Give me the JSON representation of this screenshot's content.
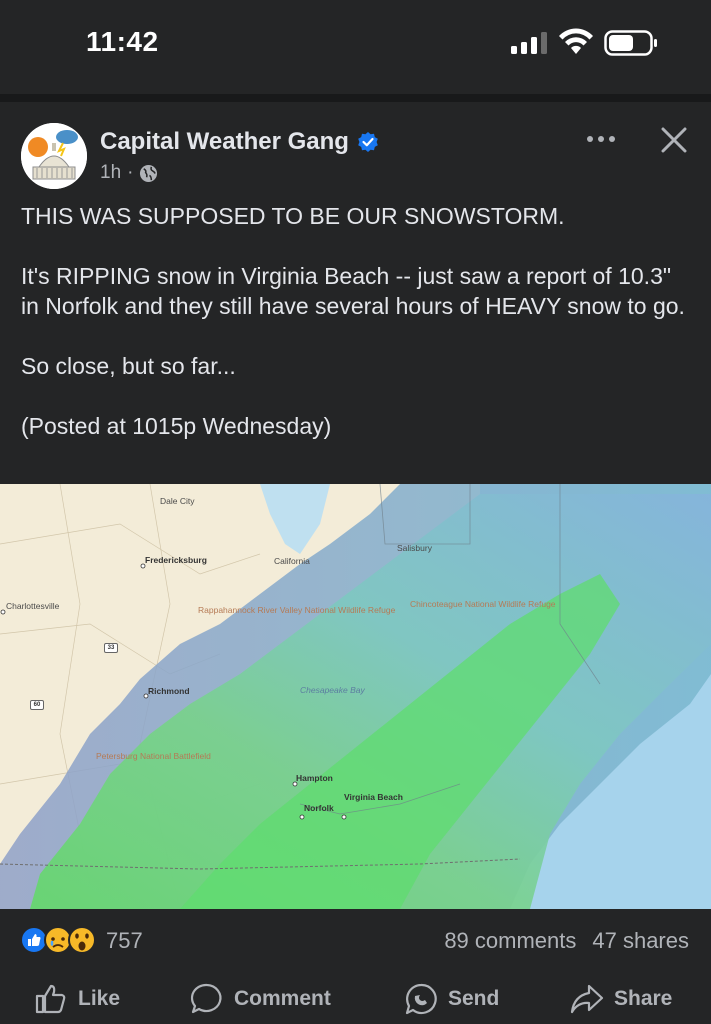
{
  "status_bar": {
    "time": "11:42",
    "icons": [
      "signal-icon",
      "wifi-icon",
      "battery-icon"
    ]
  },
  "post": {
    "author": "Capital Weather Gang",
    "verified": true,
    "time_ago": "1h",
    "separator": "·",
    "audience_icon": "globe-icon",
    "paragraphs": [
      "THIS WAS SUPPOSED TO BE OUR SNOWSTORM.",
      "It's RIPPING snow in Virginia Beach -- just saw a report of 10.3\" in Norfolk and they still have several hours of HEAVY snow to go.",
      "So close, but so far...",
      "(Posted at 1015p Wednesday)"
    ]
  },
  "map": {
    "labels": {
      "dale_city": "Dale City",
      "fredericksburg": "Fredericksburg",
      "california": "California",
      "salisbury": "Salisbury",
      "charlottesville": "Charlottesville",
      "rappahannock": "Rappahannock River Valley National Wildlife Refuge",
      "chincoteague": "Chincoteague National Wildlife Refuge",
      "richmond": "Richmond",
      "chesapeake_bay": "Chesapeake Bay",
      "petersburg": "Petersburg National Battlefield",
      "hampton": "Hampton",
      "norfolk": "Norfolk",
      "virginia_beach": "Virginia Beach",
      "hwy_33": "33",
      "hwy_60": "60"
    }
  },
  "engagement": {
    "reaction_icons": [
      "like-reaction-icon",
      "sad-reaction-icon",
      "wow-reaction-icon"
    ],
    "reaction_count": "757",
    "comments": "89 comments",
    "shares": "47 shares"
  },
  "actions": {
    "like": "Like",
    "comment": "Comment",
    "send": "Send",
    "share": "Share"
  },
  "colors": {
    "background": "#242526",
    "text": "#e4e6eb",
    "secondary_text": "#b0b3b8",
    "verified_blue": "#1877f2",
    "radar_green": "#6fe07a",
    "radar_blue": "#7fb0d8"
  }
}
